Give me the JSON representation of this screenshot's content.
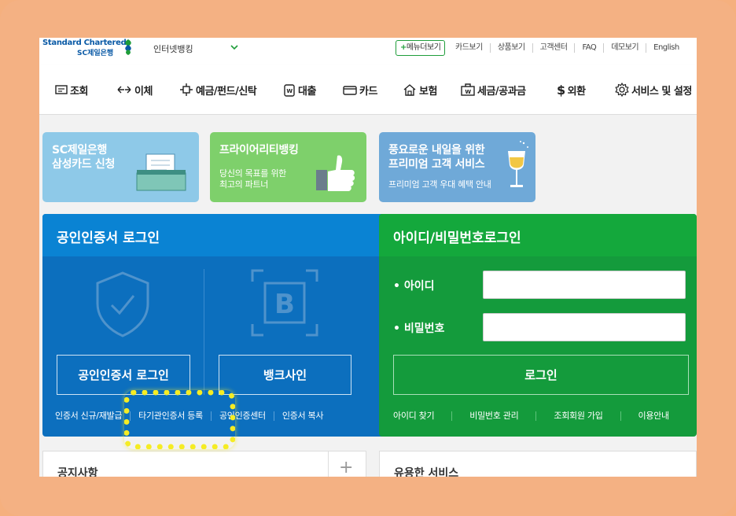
{
  "brand": {
    "logo_line1": "Standard Chartered",
    "logo_line2": "SC제일은행",
    "service_select": "인터넷뱅킹",
    "menu_view": "메뉴더보기"
  },
  "top_links": [
    "카드보기",
    "상품보기",
    "고객센터",
    "FAQ",
    "데모보기",
    "English"
  ],
  "nav": [
    {
      "label": "조회",
      "icon": "inquiry-icon"
    },
    {
      "label": "이체",
      "icon": "transfer-icon"
    },
    {
      "label": "예금/펀드/신탁",
      "icon": "deposit-icon"
    },
    {
      "label": "대출",
      "icon": "loan-icon"
    },
    {
      "label": "카드",
      "icon": "card-icon"
    },
    {
      "label": "보험",
      "icon": "insurance-icon"
    },
    {
      "label": "세금/공과금",
      "icon": "tax-icon"
    },
    {
      "label": "외환",
      "icon": "dollar-icon"
    },
    {
      "label": "서비스 및 설정",
      "icon": "gear-icon"
    }
  ],
  "banners": [
    {
      "line1": "SC제일은행",
      "line2": "삼성카드 신청",
      "sub": "",
      "color": "#8ec9e8"
    },
    {
      "line1": "프라이어리티뱅킹",
      "line2": "",
      "sub1": "당신의 목표를 위한",
      "sub2": "최고의 파트너",
      "color": "#7ed06b"
    },
    {
      "line1": "풍요로운 내일을 위한",
      "line2": "프리미엄 고객 서비스",
      "sub": "프리미엄 고객 우대 혜택 안내",
      "color": "#6fa9d8"
    }
  ],
  "cert_login": {
    "title": "공인인증서 로그인",
    "login_button": "공인인증서 로그인",
    "banksign_button": "뱅크사인",
    "links": [
      "인증서 신규/재발급",
      "타기관인증서 등록",
      "공인인증센터",
      "인증서 복사"
    ]
  },
  "id_login": {
    "title": "아이디/비밀번호로그인",
    "id_label": "• 아이디",
    "pw_label": "• 비밀번호",
    "login_button": "로그인",
    "links": [
      "아이디 찾기",
      "비밀번호 관리",
      "조회회원 가입",
      "이용안내"
    ]
  },
  "notice": {
    "title": "공지사항",
    "plus": "+"
  },
  "services": {
    "title": "유용한 서비스"
  }
}
